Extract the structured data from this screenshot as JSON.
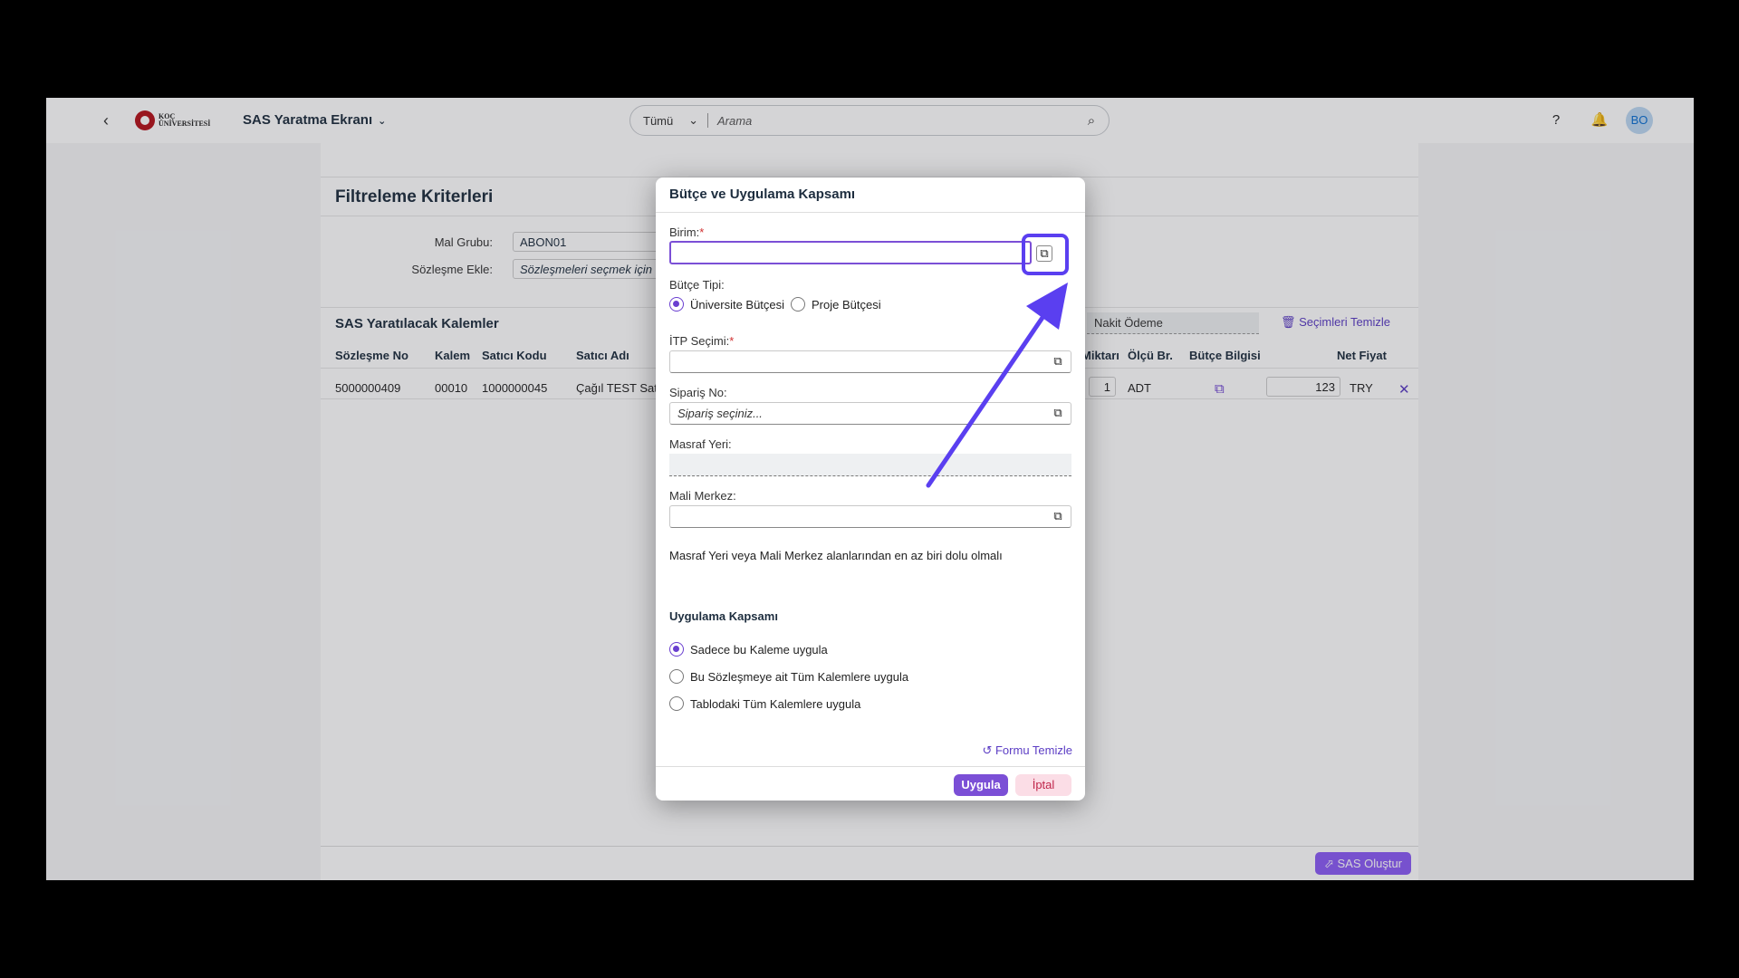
{
  "shell": {
    "logo_line1": "KOÇ",
    "logo_line2": "ÜNİVERSİTESİ",
    "app_title": "SAS Yaratma Ekranı",
    "search_scope": "Tümü",
    "search_placeholder": "Arama",
    "avatar": "BO",
    "icons": [
      "back-icon",
      "help-icon",
      "bell-icon",
      "search-icon",
      "chevron-down-icon"
    ]
  },
  "filters": {
    "title": "Filtreleme Kriterleri",
    "mal_grubu_label": "Mal Grubu:",
    "mal_grubu_value": "ABON01",
    "sozlesme_label": "Sözleşme Ekle:",
    "sozlesme_placeholder": "Sözleşmeleri seçmek için"
  },
  "items": {
    "title": "SAS Yaratılacak Kalemler",
    "payment": "Nakit Ödeme",
    "clear_selection": "Seçimleri Temizle",
    "columns": [
      "Sözleşme No",
      "Kalem",
      "Satıcı Kodu",
      "Satıcı Adı",
      "Miktarı",
      "Ölçü Br.",
      "Bütçe Bilgisi",
      "Net Fiyat"
    ],
    "row": {
      "sozlesme_no": "5000000409",
      "kalem": "00010",
      "satici_kodu": "1000000045",
      "satici_adi": "Çağıl TEST Sat",
      "miktar": "1",
      "olcu": "ADT",
      "net_fiyat": "123",
      "currency": "TRY"
    },
    "create_button": "SAS Oluştur"
  },
  "dialog": {
    "title": "Bütçe ve Uygulama Kapsamı",
    "birim_label": "Birim:",
    "butce_tipi_label": "Bütçe Tipi:",
    "butce_options": [
      "Üniversite Bütçesi",
      "Proje Bütçesi"
    ],
    "itp_label": "İTP Seçimi:",
    "siparis_label": "Sipariş No:",
    "siparis_placeholder": "Sipariş seçiniz...",
    "masraf_label": "Masraf Yeri:",
    "mali_label": "Mali Merkez:",
    "note": "Masraf Yeri veya Mali Merkez alanlarından en az biri dolu olmalı",
    "scope_title": "Uygulama Kapsamı",
    "scope_options": [
      "Sadece bu Kaleme uygula",
      "Bu Sözleşmeye ait Tüm Kalemlere uygula",
      "Tablodaki Tüm Kalemlere uygula"
    ],
    "clear_form": "Formu Temizle",
    "apply": "Uygula",
    "cancel": "İptal",
    "required_mark": "*"
  },
  "colors": {
    "accent": "#7b4fd6",
    "highlight": "#5a3ff0",
    "cancel_bg": "#fbdde6"
  }
}
